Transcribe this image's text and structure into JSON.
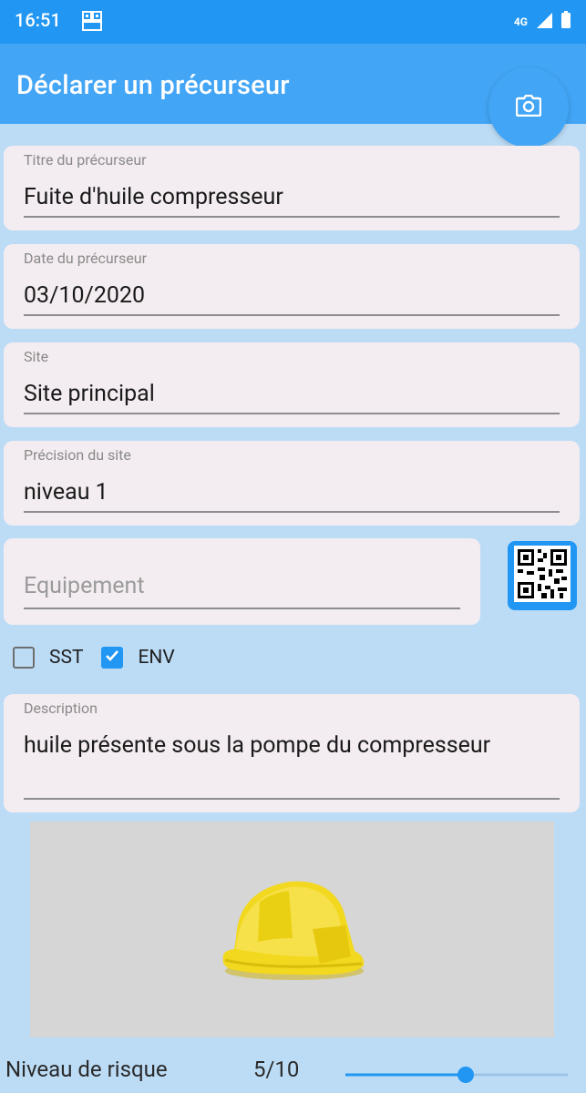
{
  "status_bar": {
    "time": "16:51",
    "network": "4G"
  },
  "app_bar": {
    "title": "Déclarer un précurseur",
    "camera_icon": "camera-icon"
  },
  "fields": {
    "titre": {
      "label": "Titre du précurseur",
      "value": "Fuite d'huile compresseur"
    },
    "date": {
      "label": "Date du précurseur",
      "value": "03/10/2020"
    },
    "site": {
      "label": "Site",
      "value": "Site principal"
    },
    "precision": {
      "label": "Précision du site",
      "value": "niveau 1"
    },
    "equipement": {
      "placeholder": "Equipement",
      "value": ""
    },
    "description": {
      "label": "Description",
      "value": "huile présente sous la pompe du compresseur"
    }
  },
  "qr_icon": "qr-code-icon",
  "checkboxes": [
    {
      "label": "SST",
      "checked": false
    },
    {
      "label": "ENV",
      "checked": true
    }
  ],
  "photo": {
    "icon": "hard-hat-icon"
  },
  "risk": {
    "label": "Niveau de risque",
    "display": "5/10",
    "value": 5,
    "max": 10
  },
  "colors": {
    "primary": "#2196f3",
    "app_bar": "#42a5f5",
    "background": "#bcdcf6",
    "field_bg": "#f3ecf0"
  }
}
